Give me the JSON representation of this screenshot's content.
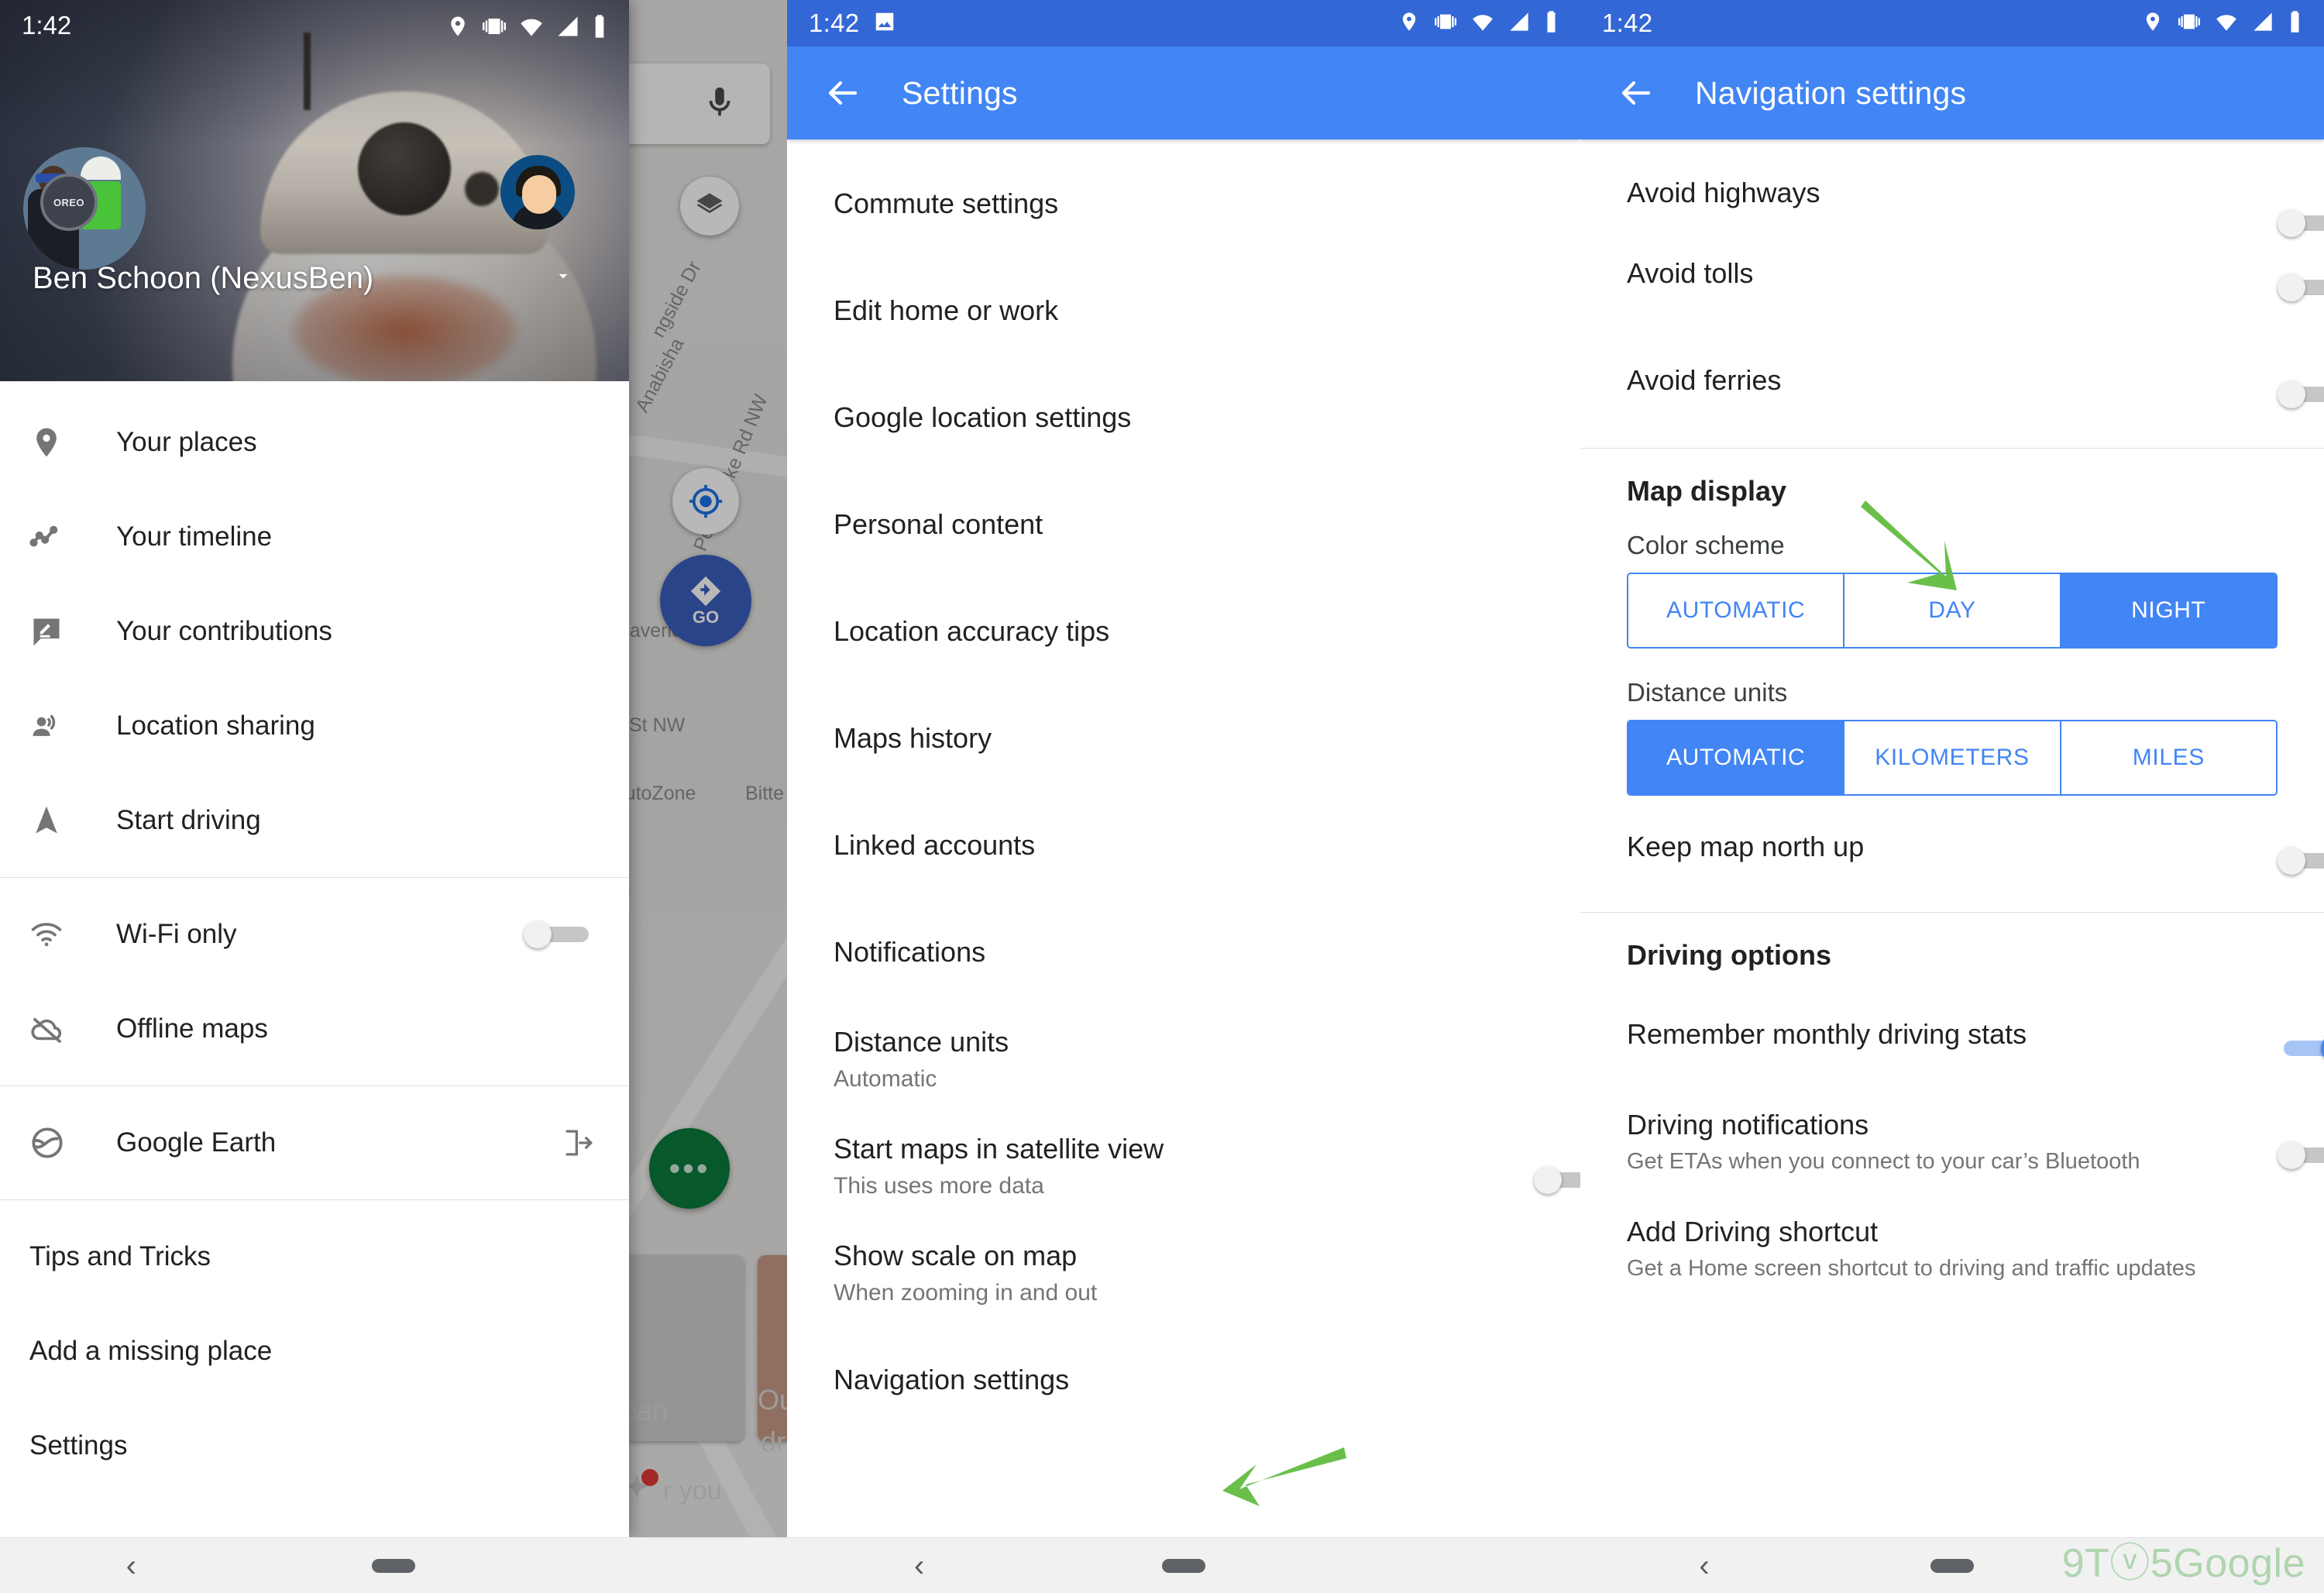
{
  "status_bar": {
    "time": "1:42"
  },
  "panel_maps": {
    "account": {
      "name": "Ben Schoon (NexusBen)",
      "avatar_label": "OREO"
    },
    "drawer_items": [
      {
        "label": "Your places",
        "icon": "place-pin-icon"
      },
      {
        "label": "Your timeline",
        "icon": "timeline-icon"
      },
      {
        "label": "Your contributions",
        "icon": "edit-contribution-icon"
      },
      {
        "label": "Location sharing",
        "icon": "person-share-icon"
      },
      {
        "label": "Start driving",
        "icon": "navigation-arrow-icon"
      }
    ],
    "drawer_toggles": [
      {
        "label": "Wi-Fi only",
        "icon": "wifi-icon",
        "on": false
      },
      {
        "label": "Offline maps",
        "icon": "cloud-off-icon",
        "on": null
      }
    ],
    "drawer_external": [
      {
        "label": "Google Earth",
        "icon": "earth-icon",
        "tail_icon": "open-in-new-icon"
      }
    ],
    "drawer_footer": [
      {
        "label": "Tips and Tricks"
      },
      {
        "label": "Add a missing place"
      },
      {
        "label": "Settings"
      }
    ],
    "map_labels": [
      "ngside Dr",
      "Pembrooke Rd NW",
      "Maverick St",
      "St NW",
      "AutoZone",
      "Bitte",
      "Anabisha"
    ],
    "map_controls": {
      "go_button": "GO",
      "more_button": "More",
      "mic_icon": "microphone-icon",
      "layers_icon": "map-layers-icon",
      "locate_icon": "my-location-icon"
    },
    "map_card_texts": [
      "can",
      "Ou",
      "dri",
      "r you"
    ]
  },
  "panel_settings": {
    "title": "Settings",
    "back_icon": "arrow-back-icon",
    "items": [
      {
        "title": "Commute settings",
        "sub": "",
        "control": "none"
      },
      {
        "title": "Edit home or work",
        "sub": "",
        "control": "none"
      },
      {
        "title": "Google location settings",
        "sub": "",
        "control": "none"
      },
      {
        "title": "Personal content",
        "sub": "",
        "control": "none"
      },
      {
        "title": "Location accuracy tips",
        "sub": "",
        "control": "none"
      },
      {
        "title": "Maps history",
        "sub": "",
        "control": "none"
      },
      {
        "title": "Linked accounts",
        "sub": "",
        "control": "none"
      },
      {
        "title": "Notifications",
        "sub": "",
        "control": "none"
      },
      {
        "title": "Distance units",
        "sub": "Automatic",
        "control": "none"
      },
      {
        "title": "Start maps in satellite view",
        "sub": "This uses more data",
        "control": "switch",
        "on": false
      },
      {
        "title": "Show scale on map",
        "sub": "When zooming in and out",
        "control": "none"
      },
      {
        "title": "Navigation settings",
        "sub": "",
        "control": "none"
      }
    ]
  },
  "panel_navigation": {
    "title": "Navigation settings",
    "back_icon": "arrow-back-icon",
    "route_options": [
      {
        "title": "Avoid highways",
        "on": false
      },
      {
        "title": "Avoid tolls",
        "on": false
      },
      {
        "title": "Avoid ferries",
        "on": false
      }
    ],
    "map_display": {
      "section_title": "Map display",
      "color_scheme": {
        "label": "Color scheme",
        "options": [
          "AUTOMATIC",
          "DAY",
          "NIGHT"
        ],
        "selected": "NIGHT"
      },
      "distance_units": {
        "label": "Distance units",
        "options": [
          "AUTOMATIC",
          "KILOMETERS",
          "MILES"
        ],
        "selected": "AUTOMATIC"
      },
      "keep_north_up": {
        "title": "Keep map north up",
        "on": false
      }
    },
    "driving_options": {
      "section_title": "Driving options",
      "items": [
        {
          "title": "Remember monthly driving stats",
          "sub": "",
          "on": true
        },
        {
          "title": "Driving notifications",
          "sub": "Get ETAs when you connect to your car’s Bluetooth",
          "on": false
        },
        {
          "title": "Add Driving shortcut",
          "sub": "Get a Home screen shortcut to driving and traffic updates",
          "on": null
        }
      ]
    }
  },
  "annotations": {
    "arrow_color": "#6abf4b",
    "arrow_1_target": "Navigation settings",
    "arrow_2_target": "NIGHT"
  },
  "watermark": {
    "text": "9Tⓥ5Google"
  },
  "colors": {
    "app_bar": "#4285f4",
    "status_bar": "#3367d6",
    "accent": "#4285f4",
    "switch_on": "#4285f4",
    "arrow_green": "#6abf4b"
  }
}
